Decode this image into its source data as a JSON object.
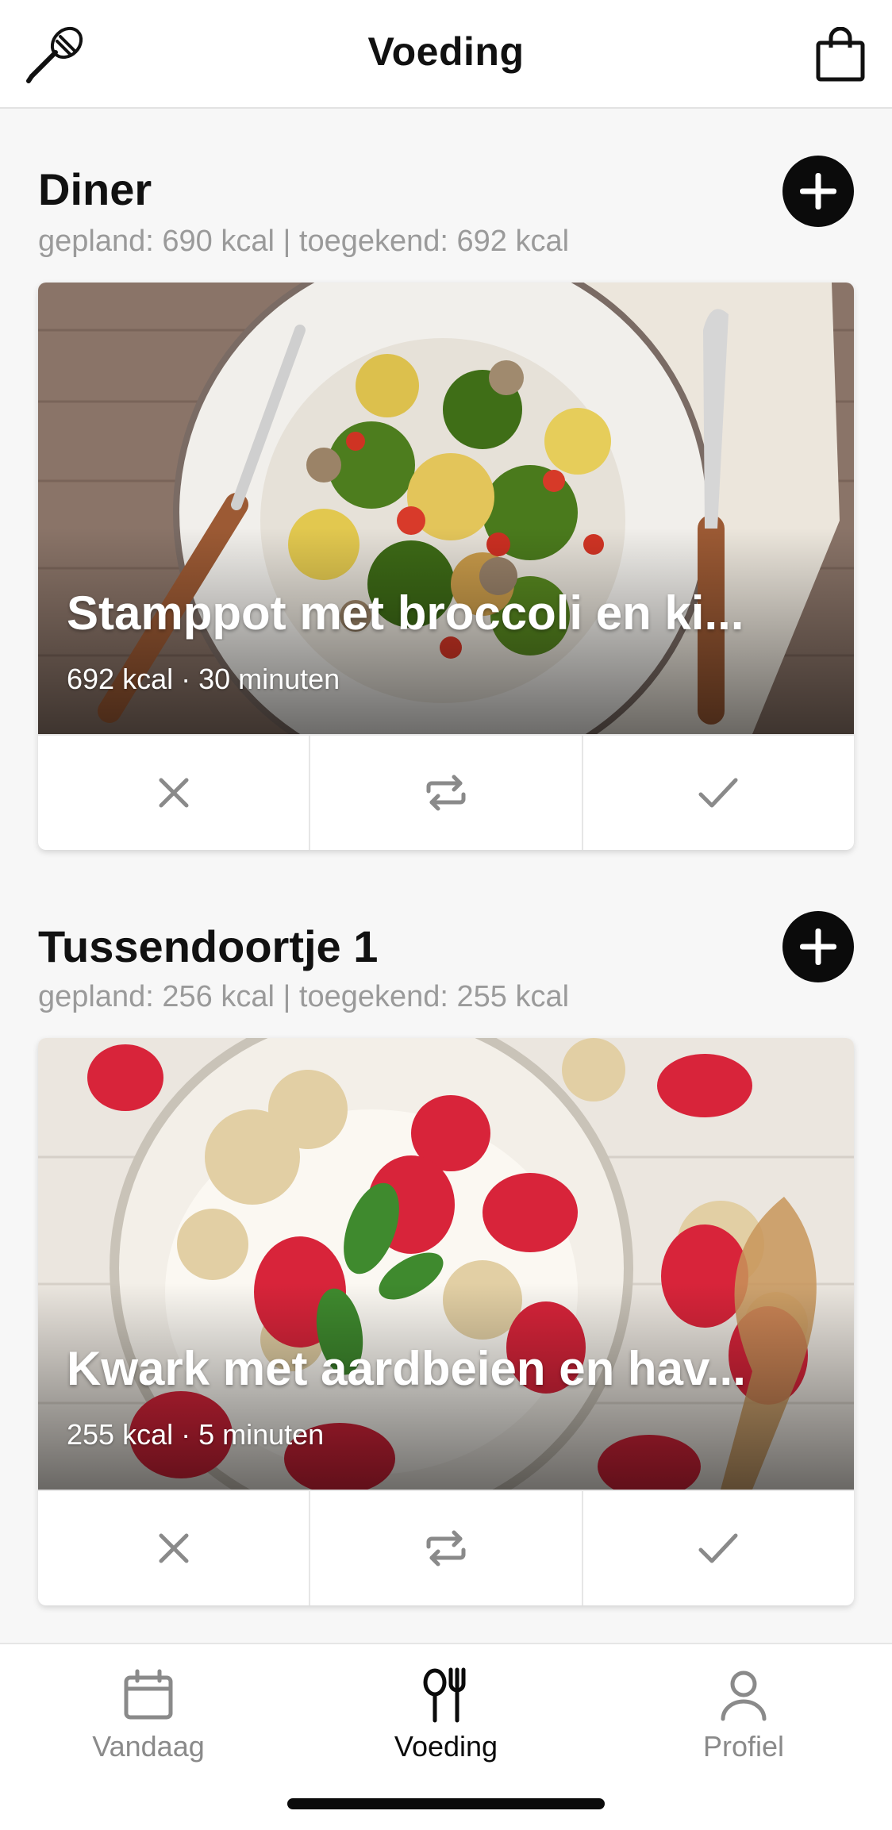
{
  "header": {
    "title": "Voeding",
    "left_icon": "whisk-icon",
    "right_icon": "shopping-bag-icon"
  },
  "meals": [
    {
      "title": "Diner",
      "subtitle": "gepland: 690 kcal | toegekend: 692 kcal",
      "recipe": {
        "name": "Stamppot met broccoli en ki...",
        "meta": "692 kcal · 30 minuten"
      },
      "actions": [
        "close-icon",
        "swap-icon",
        "check-icon"
      ]
    },
    {
      "title": "Tussendoortje 1",
      "subtitle": "gepland: 256 kcal | toegekend: 255 kcal",
      "recipe": {
        "name": "Kwark met aardbeien en hav...",
        "meta": "255 kcal · 5 minuten"
      },
      "actions": [
        "close-icon",
        "swap-icon",
        "check-icon"
      ]
    }
  ],
  "nav": {
    "items": [
      {
        "label": "Vandaag",
        "icon": "calendar-icon",
        "active": false
      },
      {
        "label": "Voeding",
        "icon": "cutlery-icon",
        "active": true
      },
      {
        "label": "Profiel",
        "icon": "person-icon",
        "active": false
      }
    ]
  },
  "colors": {
    "accent": "#0b0b0b",
    "muted": "#9a9a9a",
    "background": "#f7f7f7"
  }
}
